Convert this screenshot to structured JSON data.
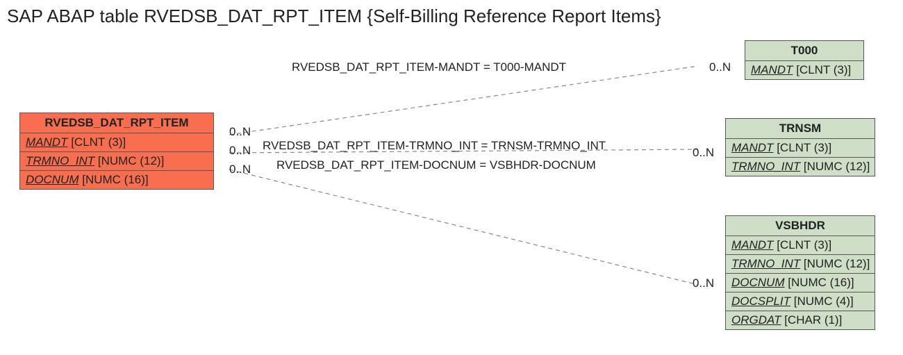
{
  "title": "SAP ABAP table RVEDSB_DAT_RPT_ITEM {Self-Billing Reference Report Items}",
  "main_entity": {
    "name": "RVEDSB_DAT_RPT_ITEM",
    "fields": [
      {
        "name": "MANDT",
        "type": "[CLNT (3)]"
      },
      {
        "name": "TRMNO_INT",
        "type": "[NUMC (12)]"
      },
      {
        "name": "DOCNUM",
        "type": "[NUMC (16)]"
      }
    ]
  },
  "related_entities": [
    {
      "name": "T000",
      "fields": [
        {
          "name": "MANDT",
          "type": "[CLNT (3)]"
        }
      ]
    },
    {
      "name": "TRNSM",
      "fields": [
        {
          "name": "MANDT",
          "type": "[CLNT (3)]"
        },
        {
          "name": "TRMNO_INT",
          "type": "[NUMC (12)]"
        }
      ]
    },
    {
      "name": "VSBHDR",
      "fields": [
        {
          "name": "MANDT",
          "type": "[CLNT (3)]"
        },
        {
          "name": "TRMNO_INT",
          "type": "[NUMC (12)]"
        },
        {
          "name": "DOCNUM",
          "type": "[NUMC (16)]"
        },
        {
          "name": "DOCSPLIT",
          "type": "[NUMC (4)]"
        },
        {
          "name": "ORGDAT",
          "type": "[CHAR (1)]"
        }
      ]
    }
  ],
  "relations": [
    {
      "label": "RVEDSB_DAT_RPT_ITEM-MANDT = T000-MANDT",
      "left_card": "0..N",
      "right_card": "0..N"
    },
    {
      "label": "RVEDSB_DAT_RPT_ITEM-TRMNO_INT = TRNSM-TRMNO_INT",
      "left_card": "0..N",
      "right_card": "0..N"
    },
    {
      "label": "RVEDSB_DAT_RPT_ITEM-DOCNUM = VSBHDR-DOCNUM",
      "left_card": "0..N",
      "right_card": "0..N"
    }
  ]
}
